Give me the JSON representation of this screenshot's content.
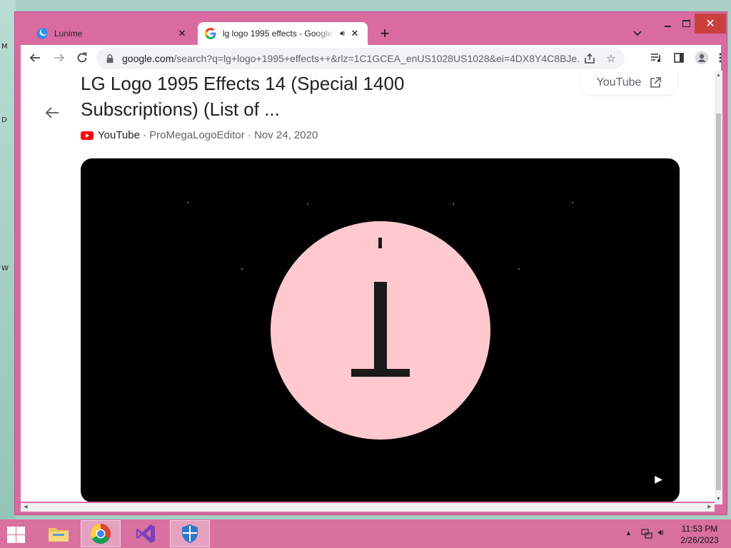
{
  "browser": {
    "tabs": [
      {
        "title": "Lunime",
        "active": false
      },
      {
        "title": "lg logo 1995 effects - Google Search",
        "active": true,
        "audio": true
      }
    ],
    "url_host": "google.com",
    "url_path": "/search?q=lg+logo+1995+effects++&rlz=1C1GCEA_enUS1028US1028&ei=4DX8Y4C8BJe..."
  },
  "result": {
    "title": "LG Logo 1995 Effects 14 (Special 1400 Subscriptions) (List of ...",
    "source": "YouTube",
    "channel": "ProMegaLogoEditor",
    "date": "Nov 24, 2020",
    "open_chip_label": "YouTube",
    "video_bg_color": "#000000",
    "logo_color": "#ffc9cf"
  },
  "taskbar": {
    "time": "11:53 PM",
    "date": "2/26/2023"
  },
  "desktop_glyphs": [
    "M",
    "D",
    "W"
  ]
}
